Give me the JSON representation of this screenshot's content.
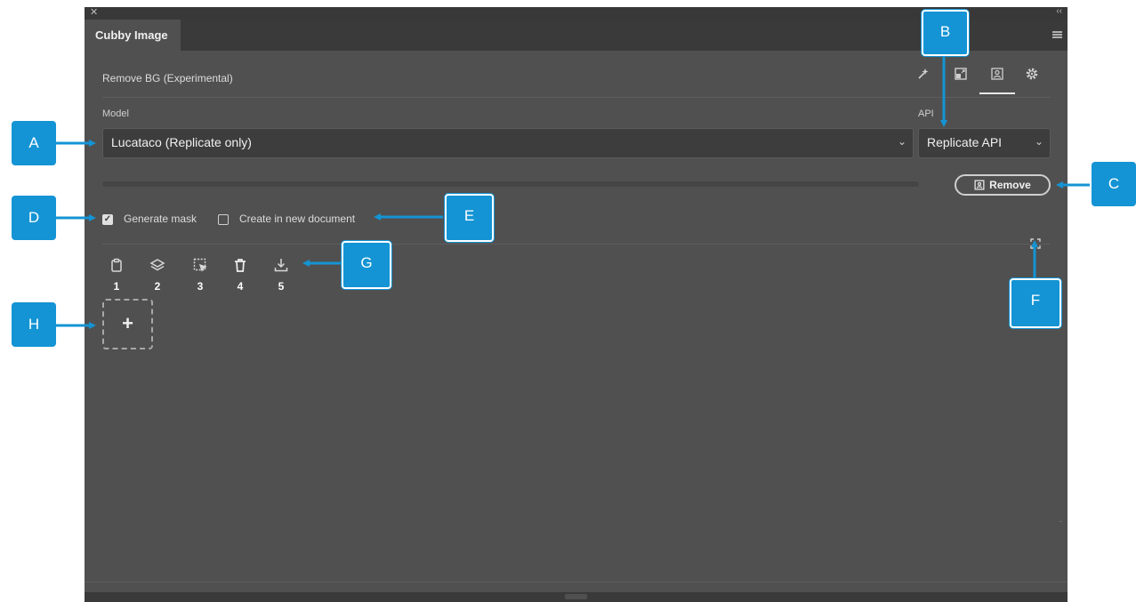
{
  "window": {
    "close_glyph": "✕",
    "collapse_glyph": "‹‹"
  },
  "tab": {
    "label": "Cubby Image"
  },
  "panel": {
    "title": "Remove BG (Experimental)"
  },
  "toolbar_icons": [
    "sparkle-wand-icon",
    "resize-icon",
    "person-frame-icon",
    "gear-icon"
  ],
  "model": {
    "label": "Model",
    "value": "Lucataco (Replicate only)"
  },
  "api": {
    "label": "API",
    "value": "Replicate API"
  },
  "remove_button": {
    "label": "Remove"
  },
  "options": {
    "generate_mask": {
      "label": "Generate mask",
      "checked": true
    },
    "create_new_doc": {
      "label": "Create in new document",
      "checked": false
    }
  },
  "actions": [
    {
      "icon": "clipboard-icon",
      "number": "1"
    },
    {
      "icon": "layers-icon",
      "number": "2"
    },
    {
      "icon": "select-region-icon",
      "number": "3"
    },
    {
      "icon": "trash-icon",
      "number": "4"
    },
    {
      "icon": "download-icon",
      "number": "5"
    }
  ],
  "add_tile": {
    "glyph": "+"
  },
  "callouts": {
    "A": "A",
    "B": "B",
    "C": "C",
    "D": "D",
    "E": "E",
    "F": "F",
    "G": "G",
    "H": "H"
  },
  "colors": {
    "panel_bg": "#505050",
    "callout": "#1494d4",
    "dark_bar": "#3a3a3a"
  }
}
